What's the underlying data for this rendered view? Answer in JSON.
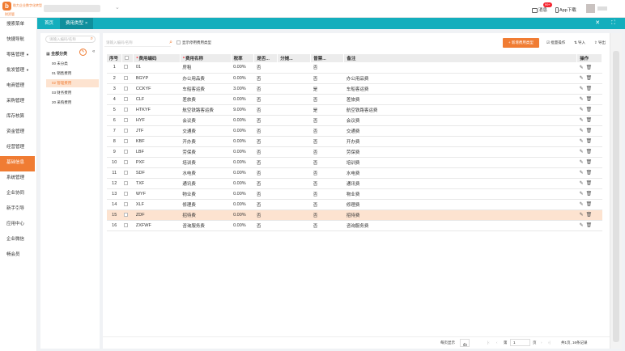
{
  "brand": {
    "tagline": "助力企业数字化转型",
    "short": "财资管"
  },
  "header": {
    "messages_label": "消息",
    "messages_badge": "99+",
    "app_label": "App下载"
  },
  "sidebar": {
    "items": [
      {
        "label": "搜索菜单",
        "arrow": ""
      },
      {
        "label": "快捷导航",
        "arrow": ""
      },
      {
        "label": "零售管理",
        "arrow": "▼"
      },
      {
        "label": "批发管理",
        "arrow": "▼"
      },
      {
        "label": "电商管理",
        "arrow": ""
      },
      {
        "label": "采购管理",
        "arrow": ""
      },
      {
        "label": "库存核算",
        "arrow": ""
      },
      {
        "label": "资金管理",
        "arrow": ""
      },
      {
        "label": "经营管理",
        "arrow": ""
      },
      {
        "label": "基础信息",
        "arrow": "",
        "active": true
      },
      {
        "label": "系统管理",
        "arrow": ""
      },
      {
        "label": "企业协同",
        "arrow": ""
      },
      {
        "label": "新手引导",
        "arrow": ""
      },
      {
        "label": "应用中心",
        "arrow": ""
      },
      {
        "label": "企业微信",
        "arrow": ""
      },
      {
        "label": "畅会员",
        "arrow": ""
      }
    ]
  },
  "tabs": {
    "home": "首页",
    "current": "费用类型",
    "close": "×",
    "tools": "✕ ⛶"
  },
  "tree": {
    "search_placeholder": "请输入编码/名称",
    "root": "全部分类",
    "nodes": [
      "00 未分类",
      "01 销售费用",
      "02 管理费用",
      "03 财务费用",
      "20 采购费用"
    ],
    "selected_index": 2
  },
  "toolbar": {
    "search_placeholder": "请输入编码/名称",
    "show_disabled": "显示停用费用类型",
    "add": "+ 新增费用类型",
    "batch": "批量操作",
    "import": "导入",
    "export": "导出"
  },
  "table": {
    "headers": [
      "序号",
      "",
      "费用编码",
      "费用名称",
      "税率",
      "是否...",
      "分摊...",
      "普票...",
      "备注",
      "操作"
    ],
    "rows": [
      {
        "no": "1",
        "code": "01",
        "name": "房租",
        "rate": "0.00%",
        "a": "否",
        "b": "",
        "c": "否",
        "remark": ""
      },
      {
        "no": "2",
        "code": "BGYP",
        "name": "办公用品费",
        "rate": "0.00%",
        "a": "否",
        "b": "",
        "c": "否",
        "remark": "办公用品费"
      },
      {
        "no": "3",
        "code": "CCKYF",
        "name": "车船客运费",
        "rate": "3.00%",
        "a": "否",
        "b": "",
        "c": "是",
        "remark": "车船客运费"
      },
      {
        "no": "4",
        "code": "CLF",
        "name": "差旅费",
        "rate": "0.00%",
        "a": "否",
        "b": "",
        "c": "否",
        "remark": "差旅费"
      },
      {
        "no": "5",
        "code": "HTKYF",
        "name": "航空铁路客运费",
        "rate": "9.00%",
        "a": "否",
        "b": "",
        "c": "是",
        "remark": "航空铁路客运费"
      },
      {
        "no": "6",
        "code": "HYF",
        "name": "会议费",
        "rate": "0.00%",
        "a": "否",
        "b": "",
        "c": "否",
        "remark": "会议费"
      },
      {
        "no": "7",
        "code": "JTF",
        "name": "交通费",
        "rate": "0.00%",
        "a": "否",
        "b": "",
        "c": "否",
        "remark": "交通费"
      },
      {
        "no": "8",
        "code": "KBF",
        "name": "开办费",
        "rate": "0.00%",
        "a": "否",
        "b": "",
        "c": "否",
        "remark": "开办费"
      },
      {
        "no": "9",
        "code": "LBF",
        "name": "劳保费",
        "rate": "0.00%",
        "a": "否",
        "b": "",
        "c": "否",
        "remark": "劳保费"
      },
      {
        "no": "10",
        "code": "PXF",
        "name": "培训费",
        "rate": "0.00%",
        "a": "否",
        "b": "",
        "c": "否",
        "remark": "培训费"
      },
      {
        "no": "11",
        "code": "SDF",
        "name": "水电费",
        "rate": "0.00%",
        "a": "否",
        "b": "",
        "c": "否",
        "remark": "水电费"
      },
      {
        "no": "12",
        "code": "TXF",
        "name": "通讯费",
        "rate": "0.00%",
        "a": "否",
        "b": "",
        "c": "否",
        "remark": "通讯费"
      },
      {
        "no": "13",
        "code": "WYF",
        "name": "物业费",
        "rate": "0.00%",
        "a": "否",
        "b": "",
        "c": "否",
        "remark": "物业费"
      },
      {
        "no": "14",
        "code": "XLF",
        "name": "修理费",
        "rate": "0.00%",
        "a": "否",
        "b": "",
        "c": "否",
        "remark": "修理费"
      },
      {
        "no": "15",
        "code": "ZDF",
        "name": "招待费",
        "rate": "0.00%",
        "a": "否",
        "b": "",
        "c": "否",
        "remark": "招待费",
        "highlight": true
      },
      {
        "no": "16",
        "code": "ZXFWF",
        "name": "咨询服务费",
        "rate": "0.00%",
        "a": "否",
        "b": "",
        "c": "否",
        "remark": "咨询服务费"
      }
    ]
  },
  "pager": {
    "page_size_label": "每页显示",
    "page_size": "50",
    "page_label_pre": "第",
    "page": "1",
    "page_label_post": "页",
    "summary": "共1页, 16条记录"
  },
  "colors": {
    "accent": "#f07c33",
    "teal": "#14aebd"
  }
}
